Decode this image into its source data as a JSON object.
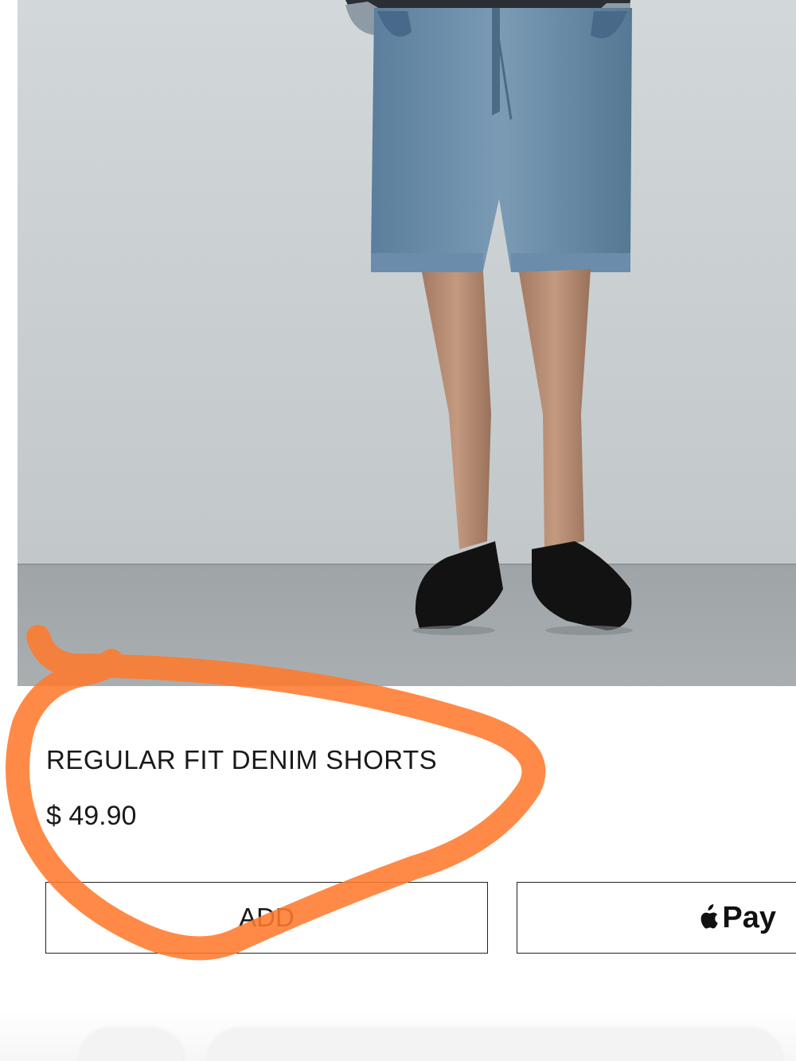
{
  "product": {
    "name": "REGULAR FIT DENIM SHORTS",
    "price": "$ 49.90"
  },
  "actions": {
    "add_label": "ADD",
    "applepay_label": "Pay"
  },
  "icons": {
    "apple": "apple-icon"
  },
  "colors": {
    "annotation": "#ff7a2e",
    "wall": "#c9cfd1",
    "floor": "#9fa5a8",
    "denim": "#5f84a3"
  }
}
